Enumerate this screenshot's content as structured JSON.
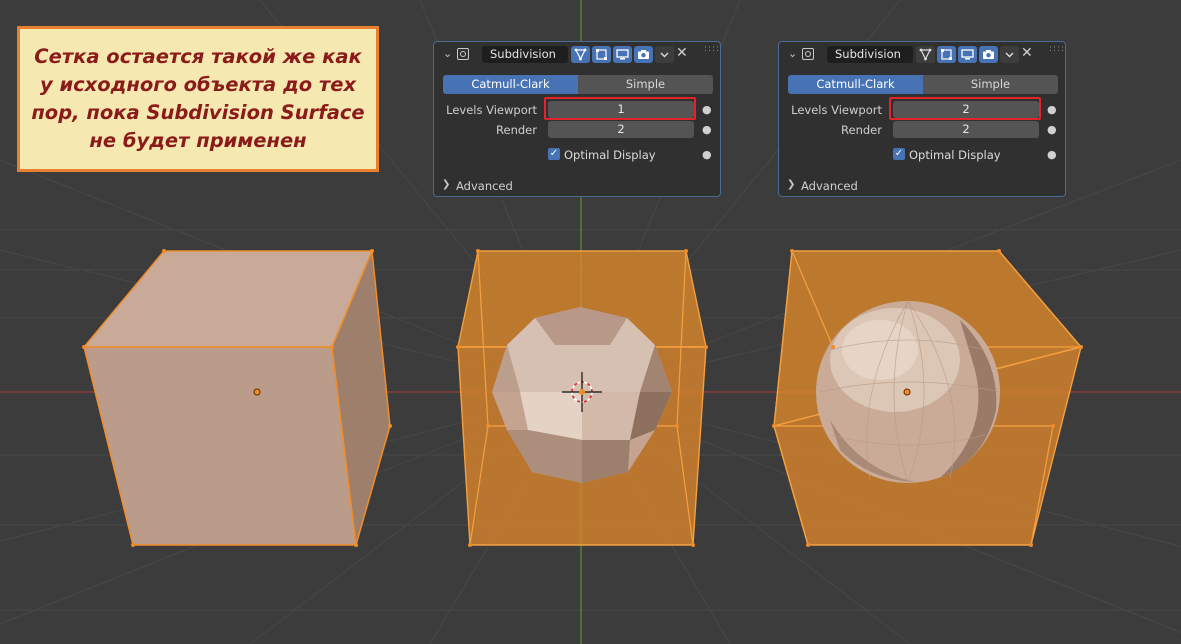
{
  "note": {
    "text": "Сетка остается такой же как у исходного объекта до тех пор, пока Subdivision Surface не будет применен"
  },
  "panels": [
    {
      "header": {
        "collapse_icon": "chevron-down-icon",
        "modifier_icon": "subdivision-modifier-icon",
        "name": "Subdivision",
        "toggles": [
          "on-cage-icon",
          "edit-mode-icon",
          "viewport-display-icon",
          "render-camera-icon"
        ],
        "dropdown_icon": "chevron-down-icon",
        "close_icon": "close-icon",
        "grip": "::::"
      },
      "tabs": {
        "catmull_clark": "Catmull-Clark",
        "simple": "Simple",
        "active": "Catmull-Clark"
      },
      "levels_viewport": {
        "label": "Levels Viewport",
        "value": "1"
      },
      "render": {
        "label": "Render",
        "value": "2"
      },
      "optimal_display": {
        "label": "Optimal Display",
        "checked": true
      },
      "advanced": {
        "label": "Advanced"
      }
    },
    {
      "header": {
        "collapse_icon": "chevron-down-icon",
        "modifier_icon": "subdivision-modifier-icon",
        "name": "Subdivision",
        "toggles": [
          "on-cage-icon",
          "edit-mode-icon",
          "viewport-display-icon",
          "render-camera-icon"
        ],
        "dropdown_icon": "chevron-down-icon",
        "close_icon": "close-icon",
        "grip": "::::"
      },
      "tabs": {
        "catmull_clark": "Catmull-Clark",
        "simple": "Simple",
        "active": "Catmull-Clark"
      },
      "levels_viewport": {
        "label": "Levels Viewport",
        "value": "2"
      },
      "render": {
        "label": "Render",
        "value": "2"
      },
      "optimal_display": {
        "label": "Optimal Display",
        "checked": true
      },
      "advanced": {
        "label": "Advanced"
      }
    }
  ],
  "colors": {
    "viewport_bg": "#3c3c3c",
    "grid_line": "#464646",
    "x_axis": "#a83a3a",
    "y_axis": "#6a9a2c",
    "selection_orange": "#f08c2a",
    "accent_blue": "#4772b3",
    "highlight_red": "#e0242a",
    "note_bg": "#f6e8b1",
    "note_text": "#8b1a1a"
  }
}
